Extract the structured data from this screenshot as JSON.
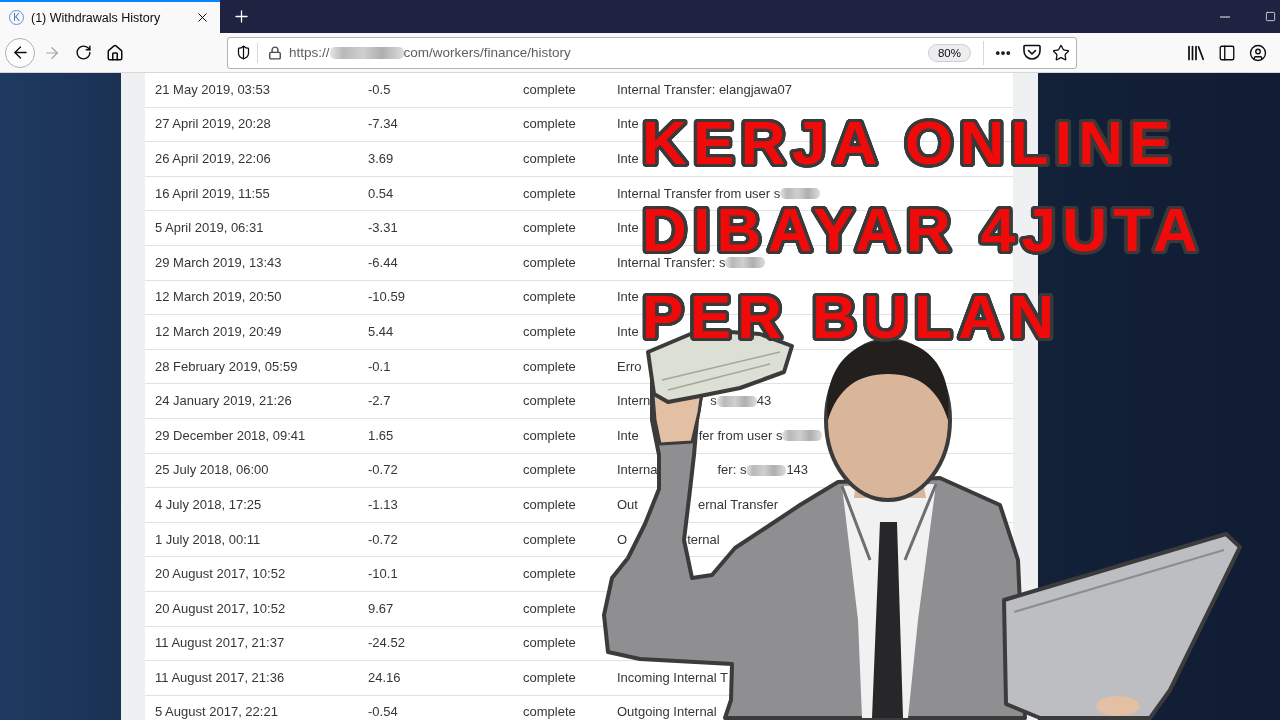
{
  "browser": {
    "tabs": [
      {
        "favicon": "K",
        "title": "(1) Withdrawals History",
        "selected": true
      }
    ],
    "nav": {
      "forward_disabled": true
    },
    "address": [
      {
        "kind": "text",
        "text": "https://"
      },
      {
        "kind": "redacted"
      },
      {
        "kind": "text",
        "text": "com/workers/finance/history"
      }
    ],
    "zoom": "80%"
  },
  "table": {
    "rows": [
      {
        "date": "21 May 2019, 03:53",
        "amount": "-0.5",
        "status": "complete",
        "description": [
          {
            "kind": "text",
            "text": "Internal Transfer: elangjawa07"
          }
        ]
      },
      {
        "date": "27 April 2019, 20:28",
        "amount": "-7.34",
        "status": "complete",
        "description": [
          {
            "kind": "text",
            "text": "Inte"
          }
        ]
      },
      {
        "date": "26 April 2019, 22:06",
        "amount": "3.69",
        "status": "complete",
        "description": [
          {
            "kind": "text",
            "text": "Inte"
          }
        ]
      },
      {
        "date": "16 April 2019, 11:55",
        "amount": "0.54",
        "status": "complete",
        "description": [
          {
            "kind": "text",
            "text": "Internal Transfer from user s"
          },
          {
            "kind": "redacted"
          }
        ]
      },
      {
        "date": "5 April 2019, 06:31",
        "amount": "-3.31",
        "status": "complete",
        "description": [
          {
            "kind": "text",
            "text": "Inte"
          }
        ]
      },
      {
        "date": "29 March 2019, 13:43",
        "amount": "-6.44",
        "status": "complete",
        "description": [
          {
            "kind": "text",
            "text": "Internal Transfer: s"
          },
          {
            "kind": "redacted"
          }
        ]
      },
      {
        "date": "12 March 2019, 20:50",
        "amount": "-10.59",
        "status": "complete",
        "description": [
          {
            "kind": "text",
            "text": "Inte"
          }
        ]
      },
      {
        "date": "12 March 2019, 20:49",
        "amount": "5.44",
        "status": "complete",
        "description": [
          {
            "kind": "text",
            "text": "Inte"
          }
        ]
      },
      {
        "date": "28 February 2019, 05:59",
        "amount": "-0.1",
        "status": "complete",
        "description": [
          {
            "kind": "text",
            "text": "Erro"
          }
        ]
      },
      {
        "date": "24 January 2019, 21:26",
        "amount": "-2.7",
        "status": "complete",
        "description": [
          {
            "kind": "text",
            "text": "Intern"
          },
          {
            "kind": "text",
            "text": "s"
          },
          {
            "kind": "redacted"
          },
          {
            "kind": "text",
            "text": "43"
          }
        ]
      },
      {
        "date": "29 December 2018, 09:41",
        "amount": "1.65",
        "status": "complete",
        "description": [
          {
            "kind": "text",
            "text": "Inte"
          },
          {
            "kind": "text",
            "text": "fer from user s"
          },
          {
            "kind": "redacted"
          }
        ]
      },
      {
        "date": "25 July 2018, 06:00",
        "amount": "-0.72",
        "status": "complete",
        "description": [
          {
            "kind": "text",
            "text": "Interna"
          },
          {
            "kind": "text",
            "text": "fer: s"
          },
          {
            "kind": "redacted"
          },
          {
            "kind": "text",
            "text": "143"
          }
        ]
      },
      {
        "date": "4 July 2018, 17:25",
        "amount": "-1.13",
        "status": "complete",
        "description": [
          {
            "kind": "text",
            "text": "Out"
          },
          {
            "kind": "text",
            "text": "ernal Transfer"
          }
        ]
      },
      {
        "date": "1 July 2018, 00:11",
        "amount": "-0.72",
        "status": "complete",
        "description": [
          {
            "kind": "text",
            "text": "O"
          },
          {
            "kind": "text",
            "text": "ternal"
          }
        ]
      },
      {
        "date": "20 August 2017, 10:52",
        "amount": "-10.1",
        "status": "complete"
      },
      {
        "date": "20 August 2017, 10:52",
        "amount": "9.67",
        "status": "complete"
      },
      {
        "date": "11 August 2017, 21:37",
        "amount": "-24.52",
        "status": "complete"
      },
      {
        "date": "11 August 2017, 21:36",
        "amount": "24.16",
        "status": "complete",
        "description": [
          {
            "kind": "text",
            "text": "Incoming Internal T"
          }
        ]
      },
      {
        "date": "5 August 2017, 22:21",
        "amount": "-0.54",
        "status": "complete",
        "description": [
          {
            "kind": "text",
            "text": "Outgoing Internal"
          }
        ]
      }
    ]
  },
  "headline": [
    "KERJA ONLINE",
    "DIBAYAR 4JUTA",
    "PER BULAN"
  ]
}
